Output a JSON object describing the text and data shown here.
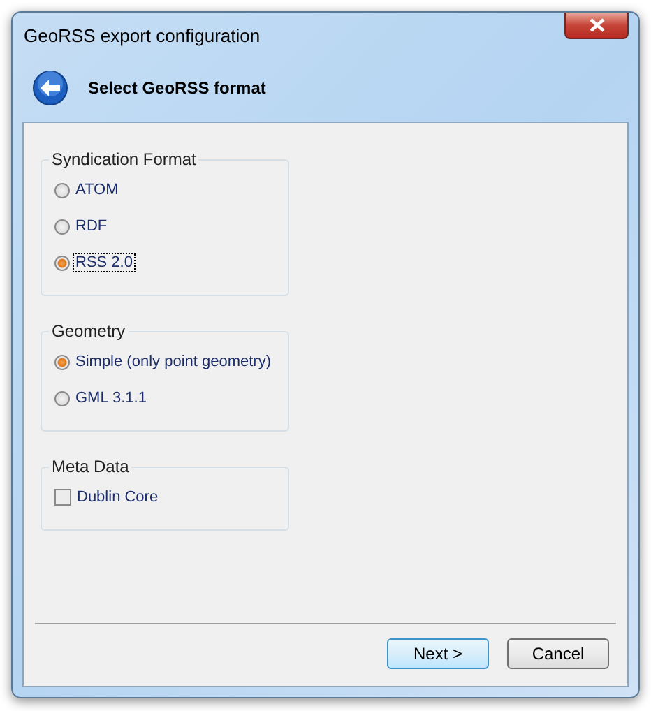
{
  "window": {
    "title": "GeoRSS export configuration"
  },
  "header": {
    "title": "Select GeoRSS format"
  },
  "groups": [
    {
      "title": "Syndication Format",
      "options": [
        {
          "kind": "radio",
          "label": "ATOM",
          "selected": false
        },
        {
          "kind": "radio",
          "label": "RDF",
          "selected": false
        },
        {
          "kind": "radio",
          "label": "RSS 2.0",
          "selected": true
        }
      ]
    },
    {
      "title": "Geometry",
      "options": [
        {
          "kind": "radio",
          "label": "Simple (only point geometry)",
          "selected": true
        },
        {
          "kind": "radio",
          "label": "GML 3.1.1",
          "selected": false
        }
      ]
    },
    {
      "title": "Meta Data",
      "options": [
        {
          "kind": "checkbox",
          "label": "Dublin Core",
          "checked": false
        }
      ]
    }
  ],
  "buttons": [
    {
      "label": "Next >",
      "default": true
    },
    {
      "label": "Cancel",
      "default": false
    }
  ]
}
